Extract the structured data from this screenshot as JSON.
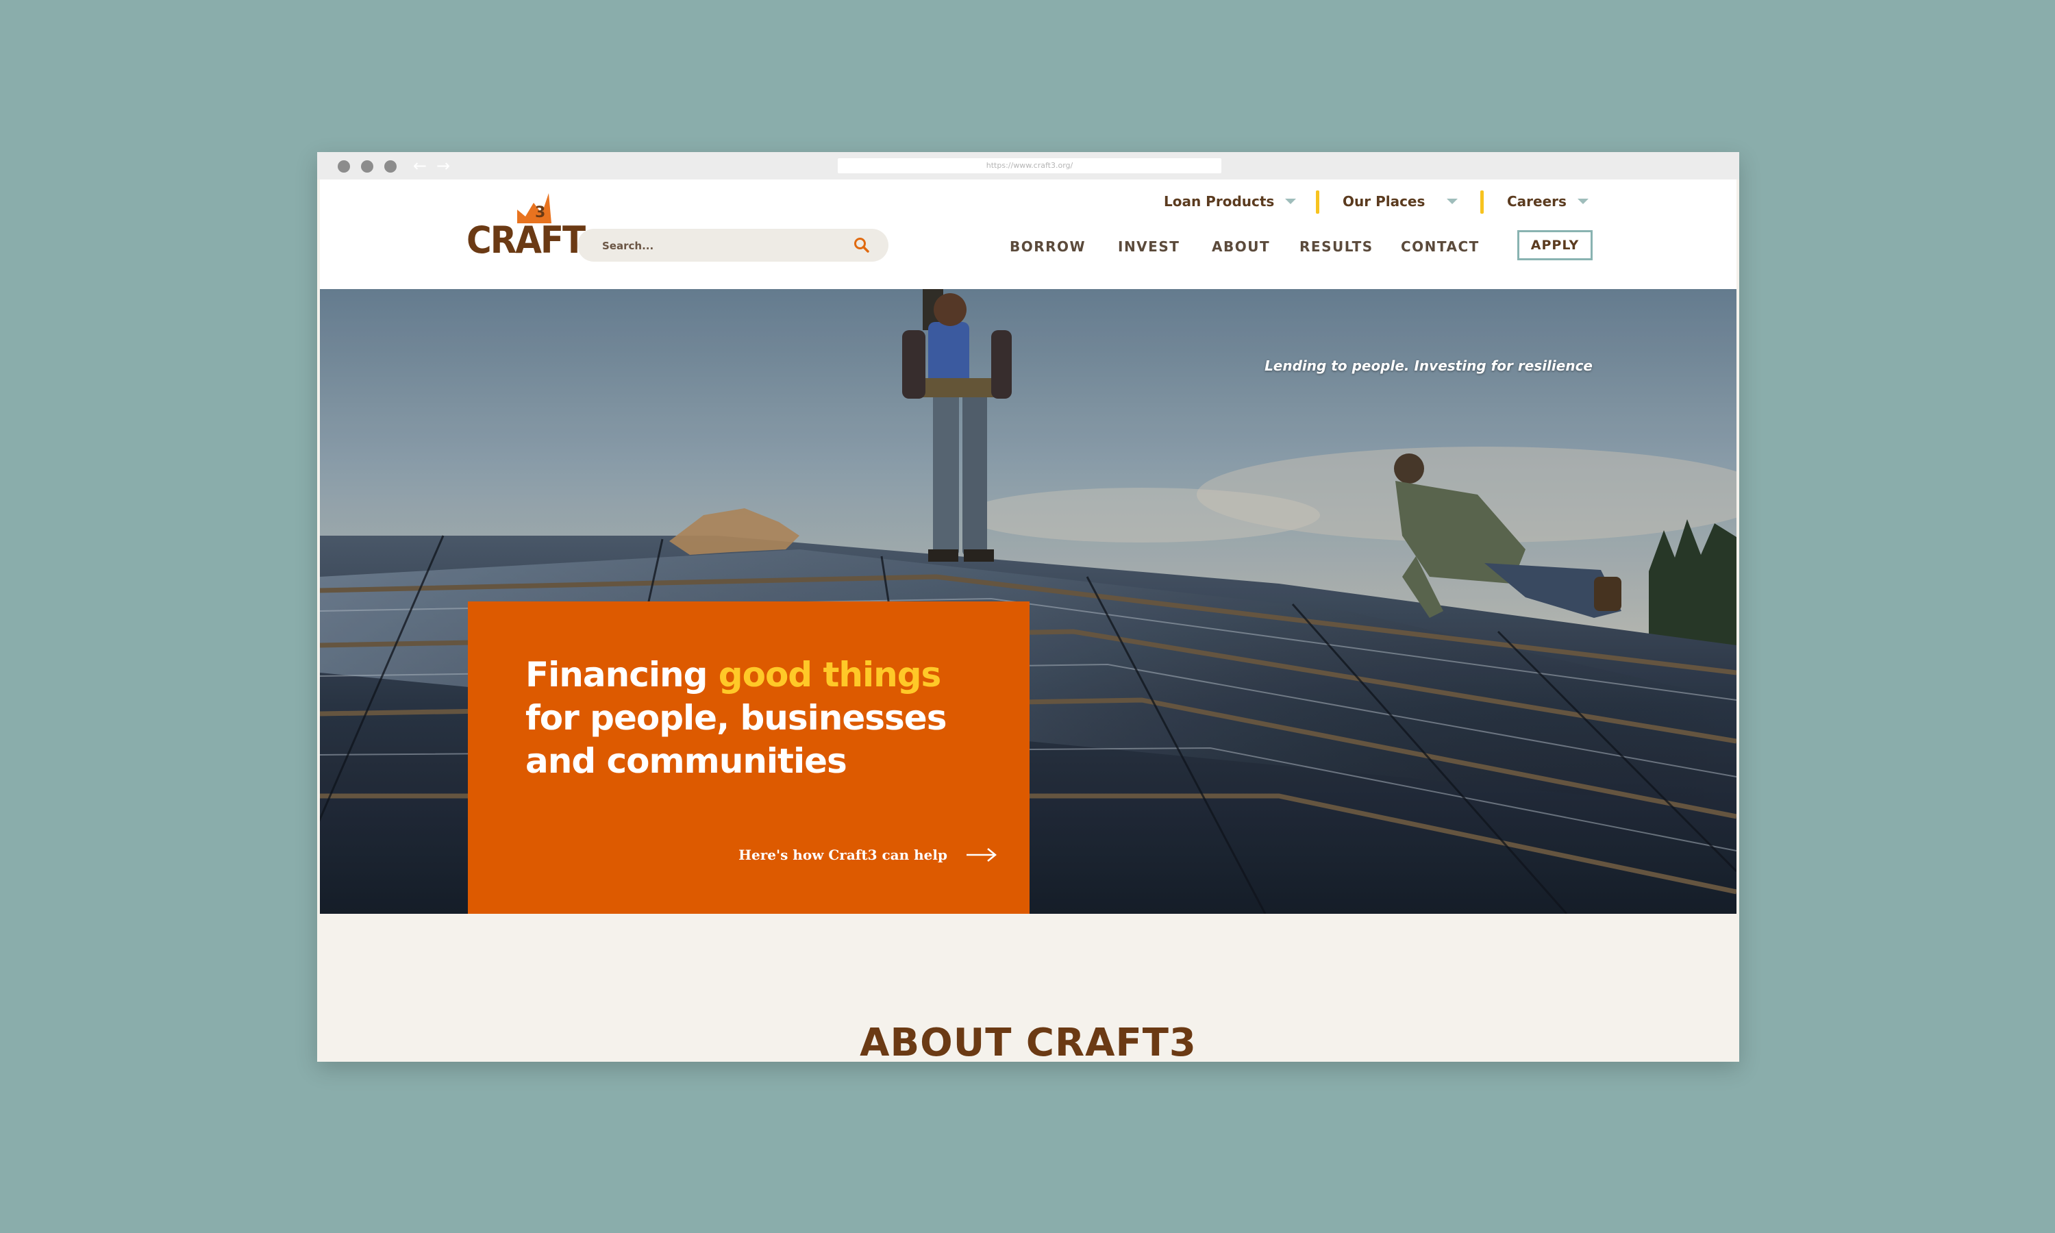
{
  "browser": {
    "url": "https://www.craft3.org/"
  },
  "header": {
    "logo_text": "CRAFT",
    "logo_badge": "3",
    "search_placeholder": "Search...",
    "top_nav": [
      {
        "label": "Loan Products"
      },
      {
        "label": "Our Places"
      },
      {
        "label": "Careers"
      }
    ],
    "main_nav": [
      {
        "label": "BORROW"
      },
      {
        "label": "INVEST"
      },
      {
        "label": "ABOUT"
      },
      {
        "label": "RESULTS"
      },
      {
        "label": "CONTACT"
      }
    ],
    "apply_label": "APPLY"
  },
  "hero": {
    "tagline": "Lending to people. Investing for resilience",
    "headline_start": "Financing ",
    "headline_highlight": "good things",
    "headline_rest": "for people, businesses and communities",
    "cta_label": "Here's how Craft3 can help"
  },
  "about": {
    "title": "ABOUT CRAFT3"
  },
  "colors": {
    "background": "#8aadab",
    "brand_orange": "#dd5a00",
    "brand_brown": "#6b3a14",
    "highlight_yellow": "#ffc928",
    "accent_teal": "#89b3b1",
    "separator_yellow": "#f7c31f"
  }
}
